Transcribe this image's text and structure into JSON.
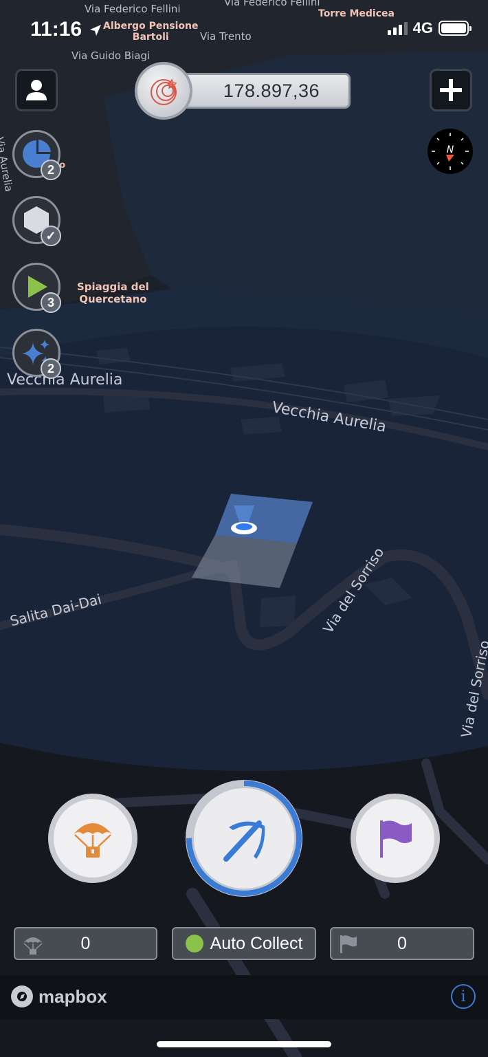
{
  "status_bar": {
    "time": "11:16",
    "network": "4G"
  },
  "map": {
    "street_labels": {
      "federico_fellini_1": "Via Federico Fellini",
      "federico_fellini_2": "Via Federico Fellini",
      "trento": "Via Trento",
      "guido_biagi": "Via Guido Biagi",
      "aurelia_left_edge": "Via Aurelia",
      "vecchia_aurelia_left": "Vecchia Aurelia",
      "vecchia_aurelia_center": "Vecchia Aurelia",
      "salita_dai_dai": "Salita Dai-Dai",
      "sorriso_1": "Via del Sorriso",
      "sorriso_2": "Via del Sorriso"
    },
    "poi_labels": {
      "torre_medicea": "Torre Medicea",
      "albergo_line1": "Albergo Pensione",
      "albergo_line2": "Bartoli",
      "spiaggia_line1": "Spiaggia del",
      "spiaggia_line2": "Quercetano",
      "partial_poi": "to"
    }
  },
  "top_bar": {
    "balance": "178.897,36",
    "profile_icon": "person-icon",
    "add_icon": "plus-icon",
    "compass_label": "N"
  },
  "side_buttons": [
    {
      "icon": "pie-chart-icon",
      "badge": "2"
    },
    {
      "icon": "hexagon-icon",
      "badge": "✓"
    },
    {
      "icon": "play-icon",
      "badge": "3"
    },
    {
      "icon": "sparkles-icon",
      "badge": "2"
    }
  ],
  "action_buttons": {
    "airdrop_icon": "parachute-icon",
    "mine_icon": "pickaxe-icon",
    "flag_icon": "flag-icon",
    "mine_progress": 0.75
  },
  "counters": {
    "airdrop_count": "0",
    "auto_collect_label": "Auto Collect",
    "flag_count": "0"
  },
  "attribution": {
    "brand": "mapbox",
    "info": "i"
  },
  "colors": {
    "accent_blue": "#3a7bd5",
    "airdrop_orange": "#e38b3a",
    "flag_purple": "#8a5bc2",
    "play_green": "#8bc34a",
    "auto_collect_green": "#8bc34a"
  }
}
